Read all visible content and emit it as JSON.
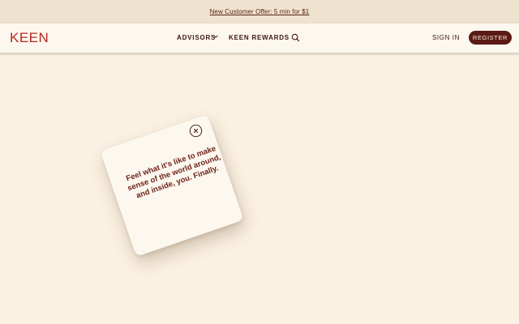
{
  "promo": {
    "text": "New Customer Offer: 5 min for $1"
  },
  "nav": {
    "logo": "KEEN",
    "advisors": "ADVISORS",
    "rewards": "KEEN REWARDS",
    "sign_in": "SIGN IN",
    "register": "REGISTER"
  },
  "icons": {
    "chevron": "chevron-down-icon",
    "search": "search-icon",
    "close": "close-icon"
  },
  "card": {
    "text": "Feel what it's like to make sense of the world around, and inside, you. Finally."
  },
  "colors": {
    "background": "#fbf1e2",
    "promo_bar": "#efe3cf",
    "nav_bar": "#fdf8ef",
    "brand_red": "#b5271e",
    "register_bg": "#5b1a14",
    "card_text": "#6b1f17"
  }
}
